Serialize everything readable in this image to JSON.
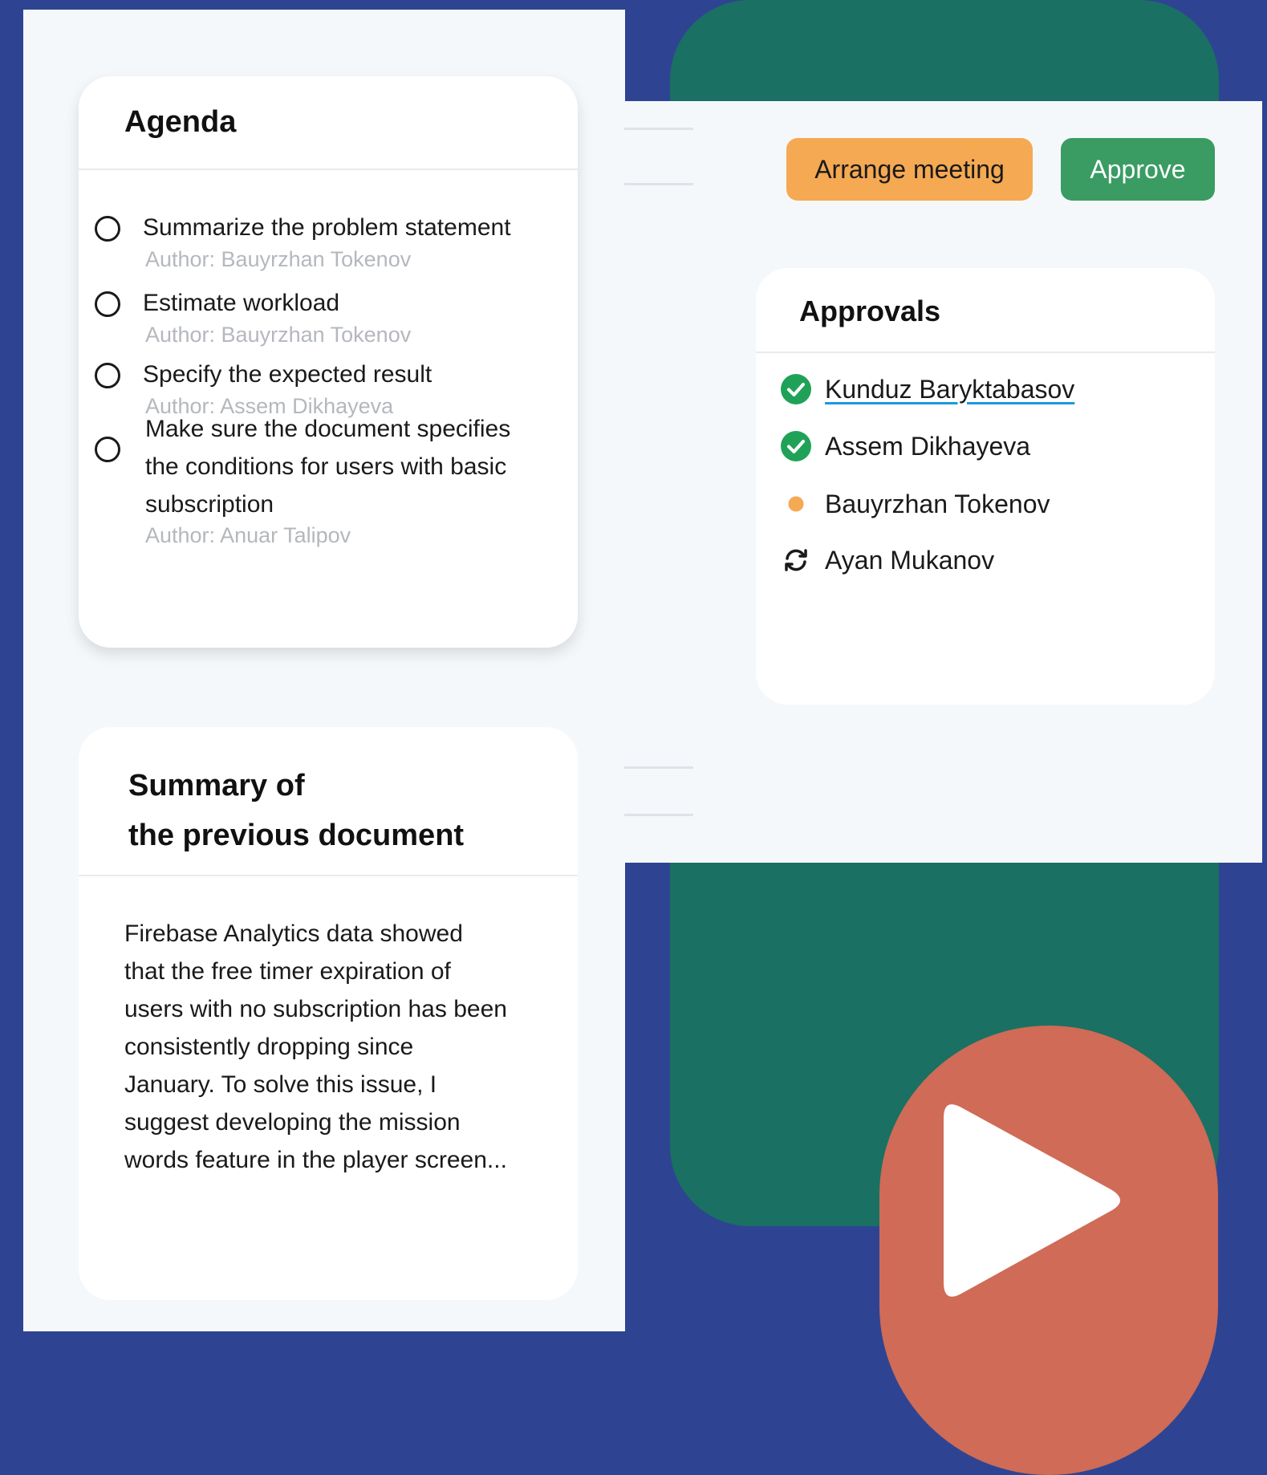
{
  "agenda": {
    "title": "Agenda",
    "items": [
      {
        "text": "Summarize the problem statement",
        "author": "Author: Bauyrzhan Tokenov"
      },
      {
        "text": "Estimate workload",
        "author": "Author:  Bauyrzhan Tokenov"
      },
      {
        "text": "Specify the expected result",
        "author": "Author: Assem Dikhayeva"
      },
      {
        "text": "Make sure the document specifies the conditions for users with basic subscription",
        "author": "Author: Anuar Talipov"
      }
    ]
  },
  "summary": {
    "title_line1": "Summary of",
    "title_line2": "the previous document",
    "body": "Firebase Analytics data showed that the free timer expiration of users with no subscription has been consistently dropping since January. To solve this issue, I suggest developing the mission words feature in the player screen..."
  },
  "actions": {
    "arrange_label": "Arrange meeting",
    "approve_label": "Approve"
  },
  "approvals": {
    "title": "Approvals",
    "people": [
      {
        "name": "Kunduz Baryktabasov",
        "status": "approved",
        "icon": "check-circle-icon"
      },
      {
        "name": "Assem Dikhayeva",
        "status": "approved",
        "icon": "check-circle-icon"
      },
      {
        "name": "Bauyrzhan Tokenov",
        "status": "pending",
        "icon": "pending-dot-icon"
      },
      {
        "name": "Ayan Mukanov",
        "status": "in-progress",
        "icon": "refresh-icon"
      }
    ]
  },
  "colors": {
    "background": "#2e4492",
    "green_panel": "#1a7063",
    "orange_circle": "#cf6b56",
    "arrange_button": "#f5a952",
    "approve_button": "#3a9c63",
    "check_green": "#1fa257",
    "pending_orange": "#f5a952",
    "link_underline": "#1a9be0"
  }
}
